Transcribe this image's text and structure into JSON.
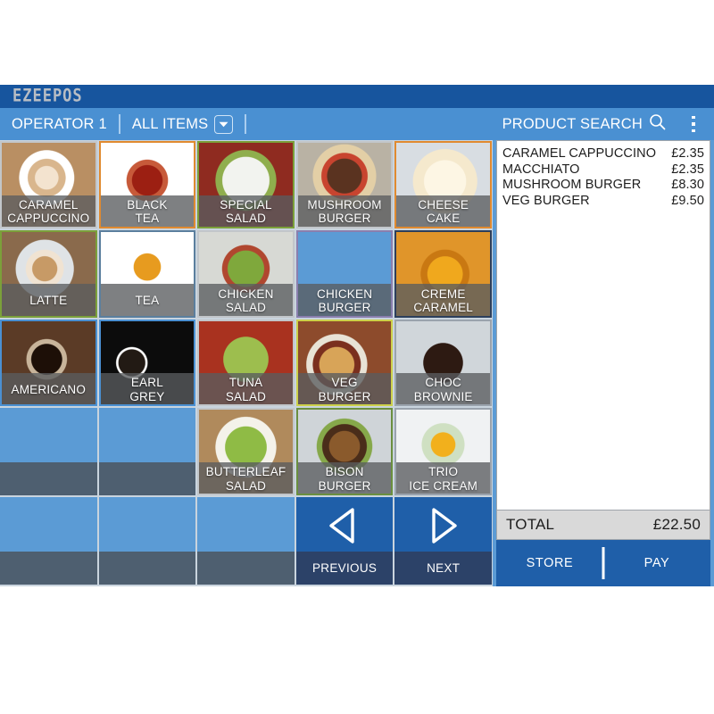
{
  "app": {
    "logo": "EZEEPOS",
    "accent_blue": "#1f5fa9",
    "bar_blue": "#4a90d2",
    "tile_blue": "#5b9bd5",
    "tile_dark": "#4e5f70"
  },
  "topbar": {
    "operator": "OPERATOR 1",
    "category": "ALL ITEMS",
    "category_caret_icon": "chevron-down-icon",
    "search_label": "PRODUCT SEARCH",
    "search_icon": "search-icon",
    "menu_icon": "kebab-menu-icon"
  },
  "grid": {
    "tiles": [
      {
        "label1": "CARAMEL",
        "label2": "CAPPUCCINO",
        "art": "a-capp",
        "border": "#c2c6ca"
      },
      {
        "label1": "BLACK",
        "label2": "TEA",
        "art": "a-blktea",
        "border": "#e08a30"
      },
      {
        "label1": "SPECIAL",
        "label2": "SALAD",
        "art": "a-specsal",
        "border": "#7ba03a"
      },
      {
        "label1": "MUSHROOM",
        "label2": "BURGER",
        "art": "a-mushbur",
        "border": "#c2c6ca"
      },
      {
        "label1": "CHEESE",
        "label2": "CAKE",
        "art": "a-cheese",
        "border": "#e08a30"
      },
      {
        "label1": "LATTE",
        "label2": "",
        "art": "a-latte",
        "border": "#7ba03a"
      },
      {
        "label1": "TEA",
        "label2": "",
        "art": "a-tea",
        "border": "#5b7f9e"
      },
      {
        "label1": "CHICKEN",
        "label2": "SALAD",
        "art": "a-chicksal",
        "border": "#c2c6ca"
      },
      {
        "label1": "CHICKEN",
        "label2": "BURGER",
        "art": "a-chickbur",
        "border": "#8a7fae"
      },
      {
        "label1": "CREME",
        "label2": "CARAMEL",
        "art": "a-creme",
        "border": "#2c3f5c"
      },
      {
        "label1": "AMERICANO",
        "label2": "",
        "art": "a-amer",
        "border": "#4a90d2"
      },
      {
        "label1": "EARL",
        "label2": "GREY",
        "art": "a-earl",
        "border": "#4a90d2"
      },
      {
        "label1": "TUNA",
        "label2": "SALAD",
        "art": "a-tuna",
        "border": "#c2c6ca"
      },
      {
        "label1": "VEG",
        "label2": "BURGER",
        "art": "a-vegbur",
        "border": "#cdd14a"
      },
      {
        "label1": "CHOC",
        "label2": "BROWNIE",
        "art": "a-choc",
        "border": "#9aa3ad"
      },
      {
        "label1": "",
        "label2": "",
        "art": "",
        "border": "",
        "empty": true
      },
      {
        "label1": "",
        "label2": "",
        "art": "",
        "border": "",
        "empty": true
      },
      {
        "label1": "BUTTERLEAF",
        "label2": "SALAD",
        "art": "a-butter",
        "border": "#c2c6ca"
      },
      {
        "label1": "BISON",
        "label2": "BURGER",
        "art": "a-bison",
        "border": "#6b8f3f"
      },
      {
        "label1": "TRIO",
        "label2": "ICE CREAM",
        "art": "a-trio",
        "border": "#9aa3ad"
      },
      {
        "label1": "",
        "label2": "",
        "art": "",
        "border": "",
        "empty": true
      },
      {
        "label1": "",
        "label2": "",
        "art": "",
        "border": "",
        "empty": true
      },
      {
        "label1": "",
        "label2": "",
        "art": "",
        "border": "",
        "empty": true
      },
      {
        "label1": "PREVIOUS",
        "label2": "",
        "art": "",
        "border": "",
        "nav": "prev",
        "icon": "triangle-left-icon"
      },
      {
        "label1": "NEXT",
        "label2": "",
        "art": "",
        "border": "",
        "nav": "next",
        "icon": "triangle-right-icon"
      }
    ]
  },
  "receipt": {
    "lines": [
      {
        "name": "CARAMEL CAPPUCCINO",
        "price": "£2.35"
      },
      {
        "name": "MACCHIATO",
        "price": "£2.35"
      },
      {
        "name": "MUSHROOM BURGER",
        "price": "£8.30"
      },
      {
        "name": "VEG BURGER",
        "price": "£9.50"
      }
    ],
    "total_label": "TOTAL",
    "total_value": "£22.50",
    "store_label": "STORE",
    "pay_label": "PAY"
  }
}
